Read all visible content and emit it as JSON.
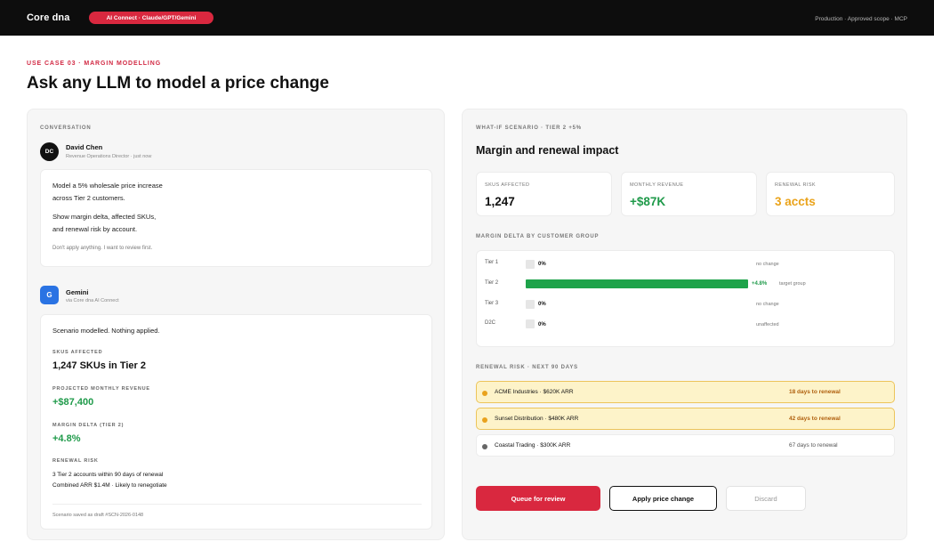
{
  "header": {
    "brand": "Core dna",
    "connect_pill": "AI Connect · Claude/GPT/Gemini",
    "env": "Production · Approved scope · MCP"
  },
  "page": {
    "eyebrow": "USE CASE 03 · MARGIN MODELLING",
    "title": "Ask any LLM to model a price change"
  },
  "conversation": {
    "label": "CONVERSATION",
    "user": {
      "initials": "DC",
      "name": "David Chen",
      "meta": "Revenue Operations Director · just now",
      "line1": "Model a 5% wholesale price increase",
      "line2": "across Tier 2 customers.",
      "line3": "Show margin delta, affected SKUs,",
      "line4": "and renewal risk by account.",
      "note": "Don't apply anything. I want to review first."
    },
    "assistant": {
      "initial": "G",
      "name": "Gemini",
      "meta": "via Core dna AI Connect",
      "intro": "Scenario modelled. Nothing applied.",
      "skus_label": "SKUS AFFECTED",
      "skus_value": "1,247 SKUs in Tier 2",
      "revenue_label": "PROJECTED MONTHLY REVENUE",
      "revenue_value": "+$87,400",
      "margin_label": "MARGIN DELTA (TIER 2)",
      "margin_value": "+4.8%",
      "risk_label": "RENEWAL RISK",
      "risk_line1": "3 Tier 2 accounts within 90 days of renewal",
      "risk_line2": "Combined ARR $1.4M · Likely to renegotiate",
      "footer": "Scenario saved as draft #SCN-2026-0148"
    }
  },
  "scenario": {
    "label": "WHAT-IF SCENARIO · TIER 2 +5%",
    "title": "Margin and renewal impact",
    "stats": [
      {
        "key": "SKUS AFFECTED",
        "value": "1,247",
        "color": "#111111"
      },
      {
        "key": "MONTHLY REVENUE",
        "value": "+$87K",
        "color": "#1f9a4a"
      },
      {
        "key": "RENEWAL RISK",
        "value": "3 accts",
        "color": "#eaa31a"
      }
    ],
    "margin_label": "MARGIN DELTA BY CUSTOMER GROUP",
    "groups": [
      {
        "name": "Tier 1",
        "value": "0%",
        "note": "no change"
      },
      {
        "name": "Tier 2",
        "value": "+4.8%",
        "note": "target group",
        "bar_fraction": 1.0,
        "bar_color": "#1ea34a"
      },
      {
        "name": "Tier 3",
        "value": "0%",
        "note": "no change"
      },
      {
        "name": "D2C",
        "value": "0%",
        "note": "unaffected"
      }
    ],
    "renewal_label": "RENEWAL RISK · NEXT 90 DAYS",
    "accounts": [
      {
        "name": "ACME Industries · $620K ARR",
        "days": "18 days to renewal",
        "level": "high"
      },
      {
        "name": "Sunset Distribution · $480K ARR",
        "days": "42 days to renewal",
        "level": "high"
      },
      {
        "name": "Coastal Trading · $300K ARR",
        "days": "67 days to renewal",
        "level": "normal"
      }
    ],
    "actions": {
      "queue": "Queue for review",
      "apply": "Apply price change",
      "discard": "Discard"
    },
    "colors": {
      "accent": "#d9283f",
      "highlight_bg": "#fdf3c9",
      "highlight_border": "#ecc45a",
      "amber_text": "#b0600e",
      "amber_dot": "#e9a21c"
    }
  }
}
